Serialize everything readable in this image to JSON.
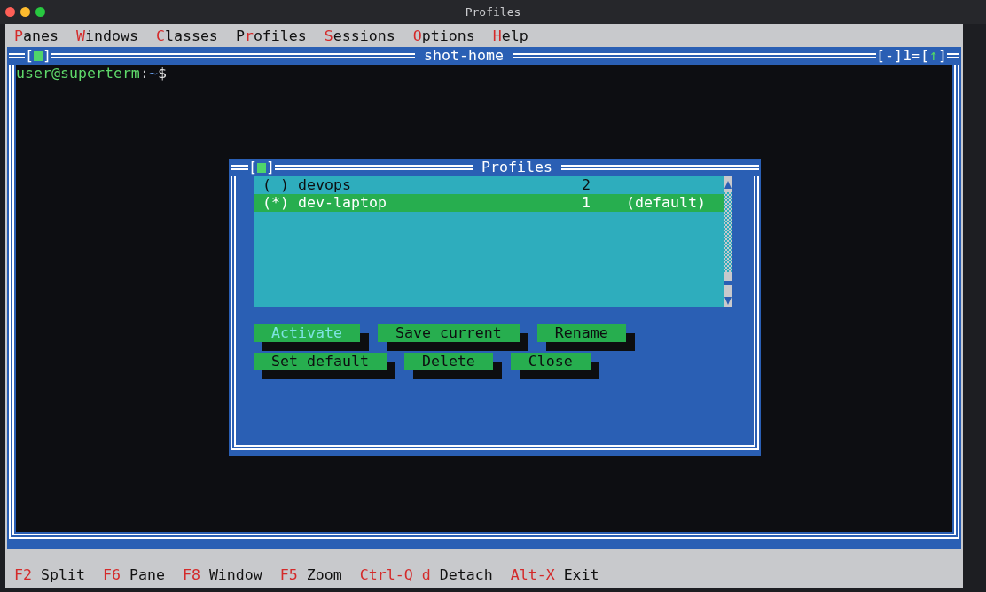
{
  "window": {
    "title": "Profiles"
  },
  "menu": [
    {
      "key": "P",
      "after": "anes"
    },
    {
      "key": "W",
      "after": "indows"
    },
    {
      "key": "C",
      "after": "lasses"
    },
    {
      "before": "P",
      "key": "r",
      "after": "ofiles"
    },
    {
      "key": "S",
      "after": "essions"
    },
    {
      "key": "O",
      "after": "ptions"
    },
    {
      "key": "H",
      "after": "elp"
    }
  ],
  "pane": {
    "close_box": {
      "open": "[",
      "close": "]"
    },
    "title": "shot-home",
    "zoom_control": "[-]",
    "pane_number": "1",
    "separator": "=",
    "scroll_control": {
      "open": "[",
      "arrow": "↑",
      "close": "]"
    },
    "prompt": {
      "user_host": "user@superterm",
      "colon": ":",
      "path": "~",
      "symbol": "$"
    }
  },
  "dialog": {
    "close_box": {
      "open": "[",
      "close": "]"
    },
    "title": "Profiles",
    "rows": [
      {
        "marker": "( )",
        "name": "devops",
        "count": "2",
        "selected": false
      },
      {
        "marker": "(*)",
        "name": "dev-laptop",
        "count": "1",
        "note": "(default)",
        "selected": true
      }
    ],
    "buttons": [
      [
        {
          "label": "Activate",
          "focused": true
        },
        {
          "label": "Save current",
          "focused": false
        },
        {
          "label": "Rename",
          "focused": false
        }
      ],
      [
        {
          "label": "Set default",
          "focused": false
        },
        {
          "label": "Delete",
          "focused": false
        },
        {
          "label": "Close",
          "focused": false
        }
      ]
    ]
  },
  "status_bar": [
    {
      "key": "F2",
      "label": "Split"
    },
    {
      "key": "F6",
      "label": "Pane"
    },
    {
      "key": "F8",
      "label": "Window"
    },
    {
      "key": "F5",
      "label": "Zoom"
    },
    {
      "key": "Ctrl-Q d",
      "label": "Detach"
    },
    {
      "key": "Alt-X",
      "label": "Exit"
    }
  ]
}
